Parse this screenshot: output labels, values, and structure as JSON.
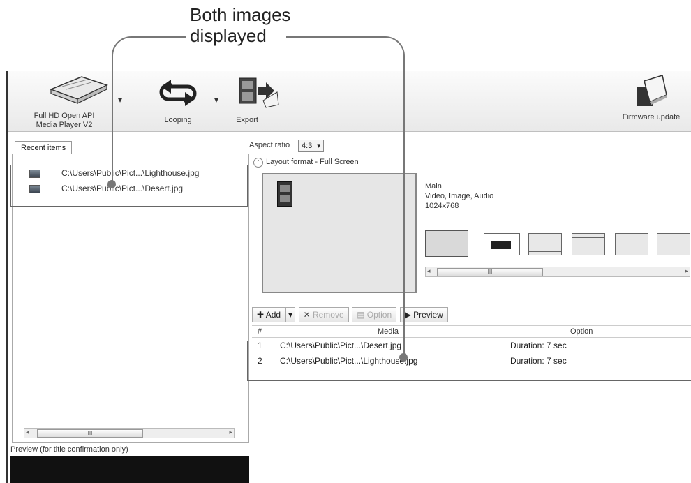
{
  "callout": {
    "line1": "Both images",
    "line2": "displayed"
  },
  "ribbon": {
    "player_label_1": "Full HD Open API",
    "player_label_2": "Media Player V2",
    "looping_label": "Looping",
    "export_label": "Export",
    "firmware_label": "Firmware update"
  },
  "recent": {
    "tab_label": "Recent items",
    "items": [
      {
        "path": "C:\\Users\\Public\\Pict...\\Lighthouse.jpg"
      },
      {
        "path": "C:\\Users\\Public\\Pict...\\Desert.jpg"
      }
    ],
    "preview_label": "Preview (for title confirmation only)"
  },
  "layout": {
    "aspect_label": "Aspect ratio",
    "aspect_value": "4:3",
    "format_label": "Layout format - Full Screen",
    "region_name": "Main",
    "region_types": "Video, Image, Audio",
    "region_size": "1024x768"
  },
  "toolbar": {
    "add": "Add",
    "remove": "Remove",
    "option": "Option",
    "preview": "Preview"
  },
  "table": {
    "headers": {
      "num": "#",
      "media": "Media",
      "option": "Option"
    },
    "rows": [
      {
        "num": "1",
        "media": "C:\\Users\\Public\\Pict...\\Desert.jpg",
        "option": "Duration: 7 sec"
      },
      {
        "num": "2",
        "media": "C:\\Users\\Public\\Pict...\\Lighthouse.jpg",
        "option": "Duration: 7 sec"
      }
    ]
  },
  "scroll_grip": "III"
}
